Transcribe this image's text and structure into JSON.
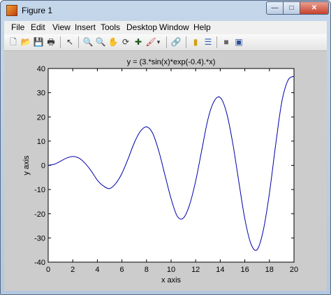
{
  "window": {
    "title": "Figure 1",
    "controls": {
      "minimize": "—",
      "maximize": "□",
      "close": "✕"
    }
  },
  "menu": [
    "File",
    "Edit",
    "View",
    "Insert",
    "Tools",
    "Desktop",
    "Window",
    "Help"
  ],
  "toolbar": [
    {
      "name": "new-figure-icon",
      "glyph": "🗋"
    },
    {
      "name": "open-file-icon",
      "glyph": "📂"
    },
    {
      "name": "save-icon",
      "glyph": "💾"
    },
    {
      "name": "print-icon",
      "glyph": "🖶"
    },
    {
      "name": "edit-plot-arrow-icon",
      "glyph": "↖"
    },
    {
      "name": "zoom-in-icon",
      "glyph": "🔍"
    },
    {
      "name": "zoom-out-icon",
      "glyph": "🔍"
    },
    {
      "name": "pan-hand-icon",
      "glyph": "✋"
    },
    {
      "name": "rotate-3d-icon",
      "glyph": "⟳"
    },
    {
      "name": "data-cursor-icon",
      "glyph": "✚"
    },
    {
      "name": "brush-icon",
      "glyph": "🖌"
    },
    {
      "name": "brush-dropdown-icon",
      "glyph": "▾"
    },
    {
      "name": "link-plot-icon",
      "glyph": "🔗"
    },
    {
      "name": "insert-colorbar-icon",
      "glyph": "▮"
    },
    {
      "name": "insert-legend-icon",
      "glyph": "☰"
    },
    {
      "name": "hide-plot-tools-icon",
      "glyph": "■"
    },
    {
      "name": "show-plot-tools-icon",
      "glyph": "▣"
    }
  ],
  "chart_data": {
    "type": "line",
    "title": "y = (3.*sin(x)*exp(-0.4).*x)",
    "xlabel": "x axis",
    "ylabel": "y axis",
    "xlim": [
      0,
      20
    ],
    "ylim": [
      -40,
      40
    ],
    "xticks": [
      0,
      2,
      4,
      6,
      8,
      10,
      12,
      14,
      16,
      18,
      20
    ],
    "yticks": [
      -40,
      -30,
      -20,
      -10,
      0,
      10,
      20,
      30,
      40
    ],
    "grid": false,
    "series": [
      {
        "color": "#0000aa",
        "x": [
          0,
          0.5,
          1,
          1.5,
          2,
          2.5,
          3,
          3.5,
          4,
          4.5,
          5,
          5.5,
          6,
          6.5,
          7,
          7.5,
          8,
          8.5,
          9,
          9.5,
          10,
          10.5,
          11,
          11.5,
          12,
          12.5,
          13,
          13.5,
          14,
          14.5,
          15,
          15.5,
          16,
          16.5,
          17,
          17.5,
          18,
          18.5,
          19,
          19.5,
          20
        ],
        "y": [
          0,
          0.48,
          1.69,
          3.01,
          3.66,
          3.02,
          0.85,
          -2.32,
          -6.14,
          -8.54,
          -9.6,
          -7.5,
          -3.35,
          2.65,
          9.24,
          14.06,
          15.89,
          13.29,
          5.88,
          -4.01,
          -13.78,
          -21.0,
          -21.78,
          -16.37,
          -6.48,
          6.36,
          19.07,
          26.49,
          28.0,
          22.0,
          9.66,
          -6.4,
          -22.12,
          -32.47,
          -34.84,
          -26.9,
          -11.56,
          8.16,
          26.0,
          35.0,
          36.87
        ]
      }
    ]
  }
}
